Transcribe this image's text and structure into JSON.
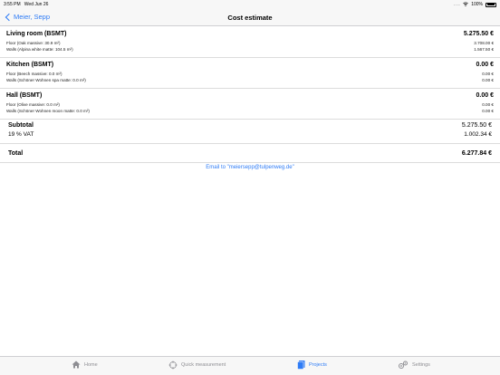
{
  "status": {
    "time": "3:55 PM",
    "date": "Wed Jun 26",
    "battery": "100%"
  },
  "nav": {
    "back_label": "Meier, Sepp",
    "title": "Cost estimate"
  },
  "rooms": [
    {
      "name": "Living room (BSMT)",
      "total": "5.275.50 €",
      "lines": [
        {
          "label": "Floor (Oak massive: 30.9 m²)",
          "value": "3.708.00 €"
        },
        {
          "label": "Walls (Alpina white matte: 104.5 m²)",
          "value": "1.567.50 €"
        }
      ]
    },
    {
      "name": "Kitchen (BSMT)",
      "total": "0.00 €",
      "lines": [
        {
          "label": "Floor (Beech massive: 0.0 m²)",
          "value": "0.00 €"
        },
        {
          "label": "Walls (Schöner Wohnen spa matte: 0.0 m²)",
          "value": "0.00 €"
        }
      ]
    },
    {
      "name": "Hall (BSMT)",
      "total": "0.00 €",
      "lines": [
        {
          "label": "Floor (Olive massive: 0.0 m²)",
          "value": "0.00 €"
        },
        {
          "label": "Walls (Schöner Wohnen moon matte: 0.0 m²)",
          "value": "0.00 €"
        }
      ]
    }
  ],
  "summary": {
    "subtotal_label": "Subtotal",
    "subtotal_value": "5.275.50 €",
    "vat_label": "19 % VAT",
    "vat_value": "1.002.34 €",
    "total_label": "Total",
    "total_value": "6.277.84 €"
  },
  "email_link": "Email to \"meiersepp@tulpenweg.de\"",
  "tabs": [
    {
      "label": "Home",
      "icon": "home-icon",
      "active": false
    },
    {
      "label": "Quick measurement",
      "icon": "crosshair-icon",
      "active": false
    },
    {
      "label": "Projects",
      "icon": "projects-icon",
      "active": true
    },
    {
      "label": "Settings",
      "icon": "gear-icon",
      "active": false
    }
  ],
  "colors": {
    "accent": "#2f7cf6",
    "inactive": "#8e8e93",
    "bar_bg": "#f7f7f7"
  }
}
